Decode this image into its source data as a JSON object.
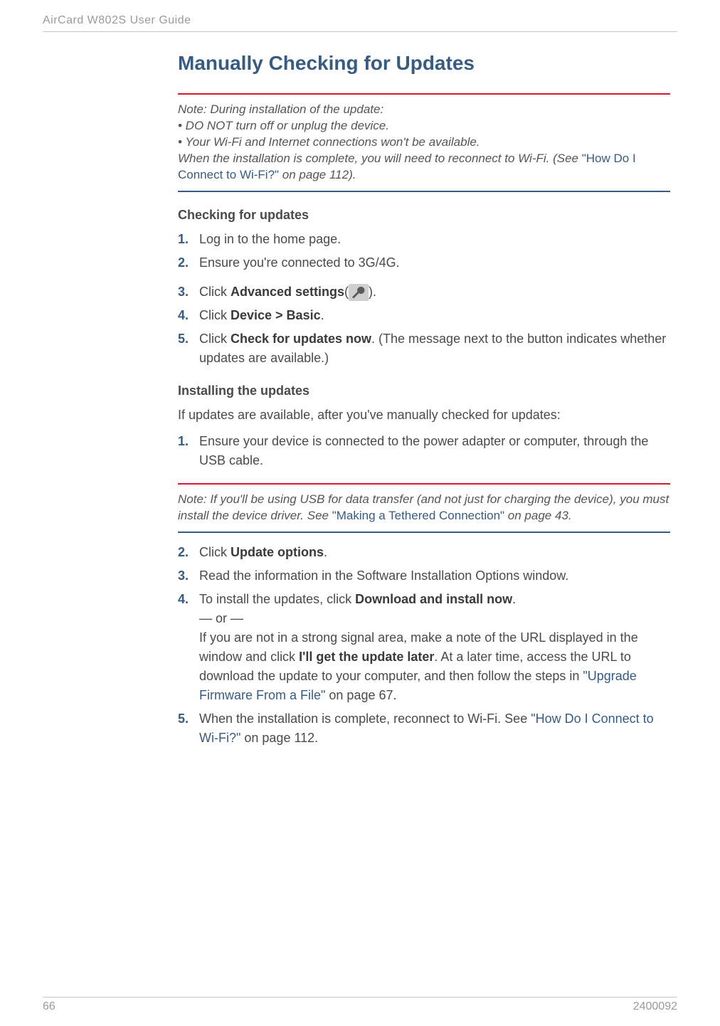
{
  "running_head": "AirCard W802S User Guide",
  "section_title": "Manually Checking for Updates",
  "note1": {
    "lead": "Note:  During installation of the update:",
    "bullets": [
      "•  DO NOT turn off or unplug the device.",
      "•  Your Wi-Fi and Internet connections won't be available."
    ],
    "tail_before": "When the installation is complete, you will need to reconnect to Wi-Fi. (See ",
    "tail_link": "\"How Do I Connect to Wi-Fi?\"",
    "tail_after": " on page 112)."
  },
  "checking": {
    "heading": "Checking for updates",
    "steps": [
      {
        "num": "1.",
        "text": "Log in to the home page."
      },
      {
        "num": "2.",
        "text": "Ensure you're connected to 3G/4G."
      },
      {
        "num": "3.",
        "prefix": "Click ",
        "bold": "Advanced settings",
        "suffix_open": "(",
        "suffix_close": ")."
      },
      {
        "num": "4.",
        "prefix": "Click ",
        "bold": "Device > Basic",
        "suffix": "."
      },
      {
        "num": "5.",
        "prefix": "Click ",
        "bold": "Check for updates now",
        "suffix": ". (The message next to the button indicates whether updates are available.)"
      }
    ]
  },
  "installing": {
    "heading": "Installing the updates",
    "intro": "If updates are available, after you've manually checked for updates:",
    "step1": {
      "num": "1.",
      "text": "Ensure your device is connected to the power adapter or computer, through the USB cable."
    }
  },
  "note2": {
    "before": "Note:  If you'll be using USB for data transfer (and not just for charging the device), you must install the device driver. See ",
    "link": "\"Making a Tethered Connection\"",
    "after": " on page 43."
  },
  "steps2": [
    {
      "num": "2.",
      "prefix": "Click ",
      "bold": "Update options",
      "suffix": "."
    },
    {
      "num": "3.",
      "text": "Read the information in the Software Installation Options window."
    },
    {
      "num": "4.",
      "line1_prefix": "To install the updates, click ",
      "line1_bold": "Download and install now",
      "line1_suffix": ".",
      "or": "— or —",
      "line2_a": "If you are not in a strong signal area, make a note of the URL displayed in the window and click ",
      "line2_bold": "I'll get the update later",
      "line2_b": ". At a later time, access the URL to download the update to your computer, and then follow the steps in ",
      "line2_link": "\"Upgrade Firmware From a File\"",
      "line2_c": " on page 67."
    },
    {
      "num": "5.",
      "prefix": "When the installation is complete, reconnect to Wi-Fi. See ",
      "link": "\"How Do I Connect to Wi-Fi?\"",
      "suffix": " on page 112."
    }
  ],
  "footer": {
    "page_num": "66",
    "doc_num": "2400092"
  }
}
